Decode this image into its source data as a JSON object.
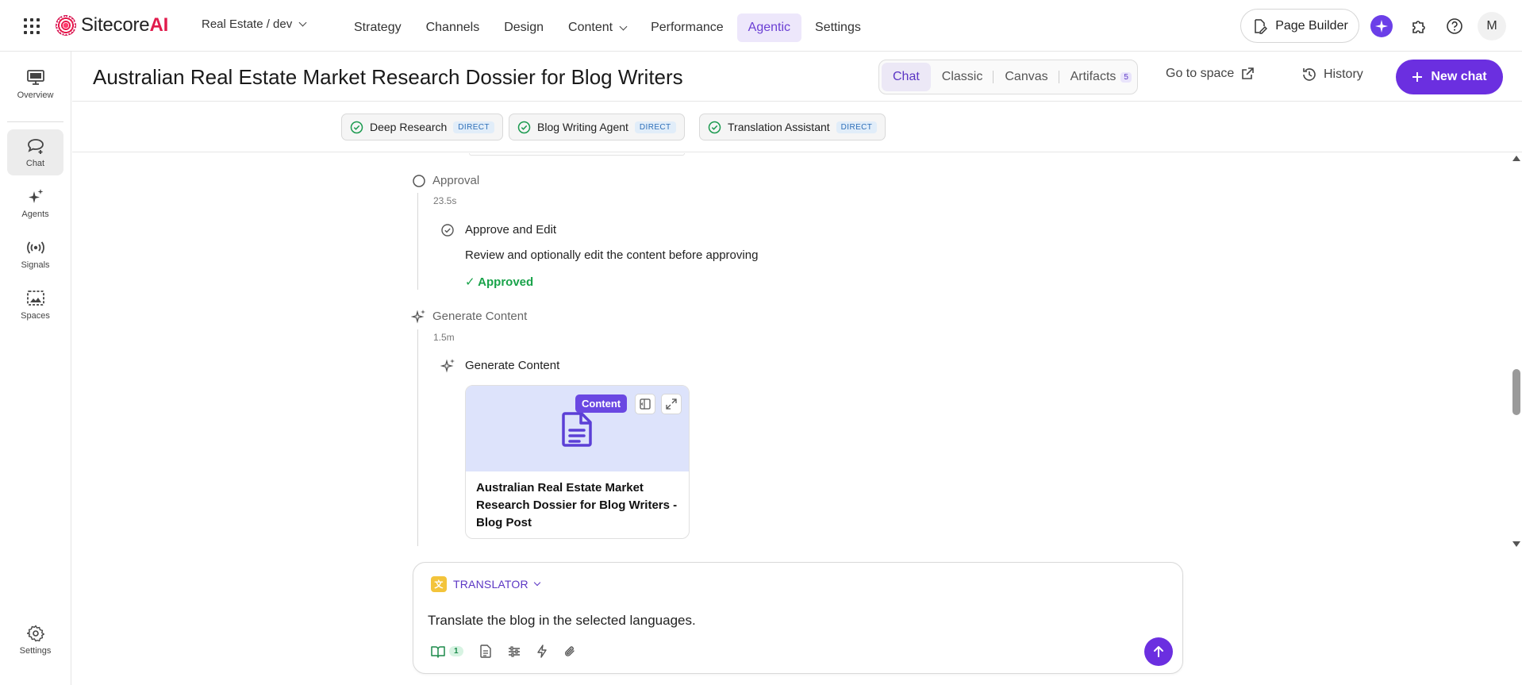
{
  "topbar": {
    "brand": "Sitecore",
    "brand_suffix": "AI",
    "environment": "Real Estate / dev",
    "nav": [
      "Strategy",
      "Channels",
      "Design",
      "Content",
      "Performance",
      "Agentic",
      "Settings"
    ],
    "active_nav": "Agentic",
    "page_builder_label": "Page Builder",
    "avatar_initial": "M"
  },
  "rail": {
    "items": [
      {
        "label": "Overview",
        "icon": "monitor-icon"
      },
      {
        "label": "Chat",
        "icon": "chat-plus-icon"
      },
      {
        "label": "Agents",
        "icon": "sparkles-icon"
      },
      {
        "label": "Signals",
        "icon": "broadcast-icon"
      },
      {
        "label": "Spaces",
        "icon": "spaces-icon"
      }
    ],
    "active": "Chat",
    "settings_label": "Settings"
  },
  "chat_header": {
    "title": "Australian Real Estate Market Research Dossier for Blog Writers",
    "tabs": [
      "Chat",
      "Classic",
      "Canvas",
      "Artifacts"
    ],
    "active_tab": "Chat",
    "artifacts_count": "5",
    "goto_space": "Go to space",
    "history": "History",
    "new_chat": "New chat"
  },
  "agents": [
    {
      "name": "Deep Research",
      "tag": "DIRECT"
    },
    {
      "name": "Blog Writing Agent",
      "tag": "DIRECT"
    },
    {
      "name": "Translation Assistant",
      "tag": "DIRECT"
    }
  ],
  "timeline": {
    "approval": {
      "title": "Approval",
      "time": "23.5s",
      "sub_title": "Approve and Edit",
      "desc": "Review and optionally edit the content before approving",
      "status": "✓ Approved"
    },
    "generate": {
      "title": "Generate Content",
      "time": "1.5m",
      "sub_title": "Generate Content",
      "card": {
        "badge": "Content",
        "title": "Australian Real Estate Market Research Dossier for Blog Writers - Blog Post"
      }
    }
  },
  "composer": {
    "agent": "TRANSLATOR",
    "text": "Translate the blog in the selected languages.",
    "knowledge_count": "1"
  },
  "colors": {
    "accent": "#6b2fe0",
    "approved": "#19a34a",
    "direct_tag": "#2f6fb8"
  }
}
